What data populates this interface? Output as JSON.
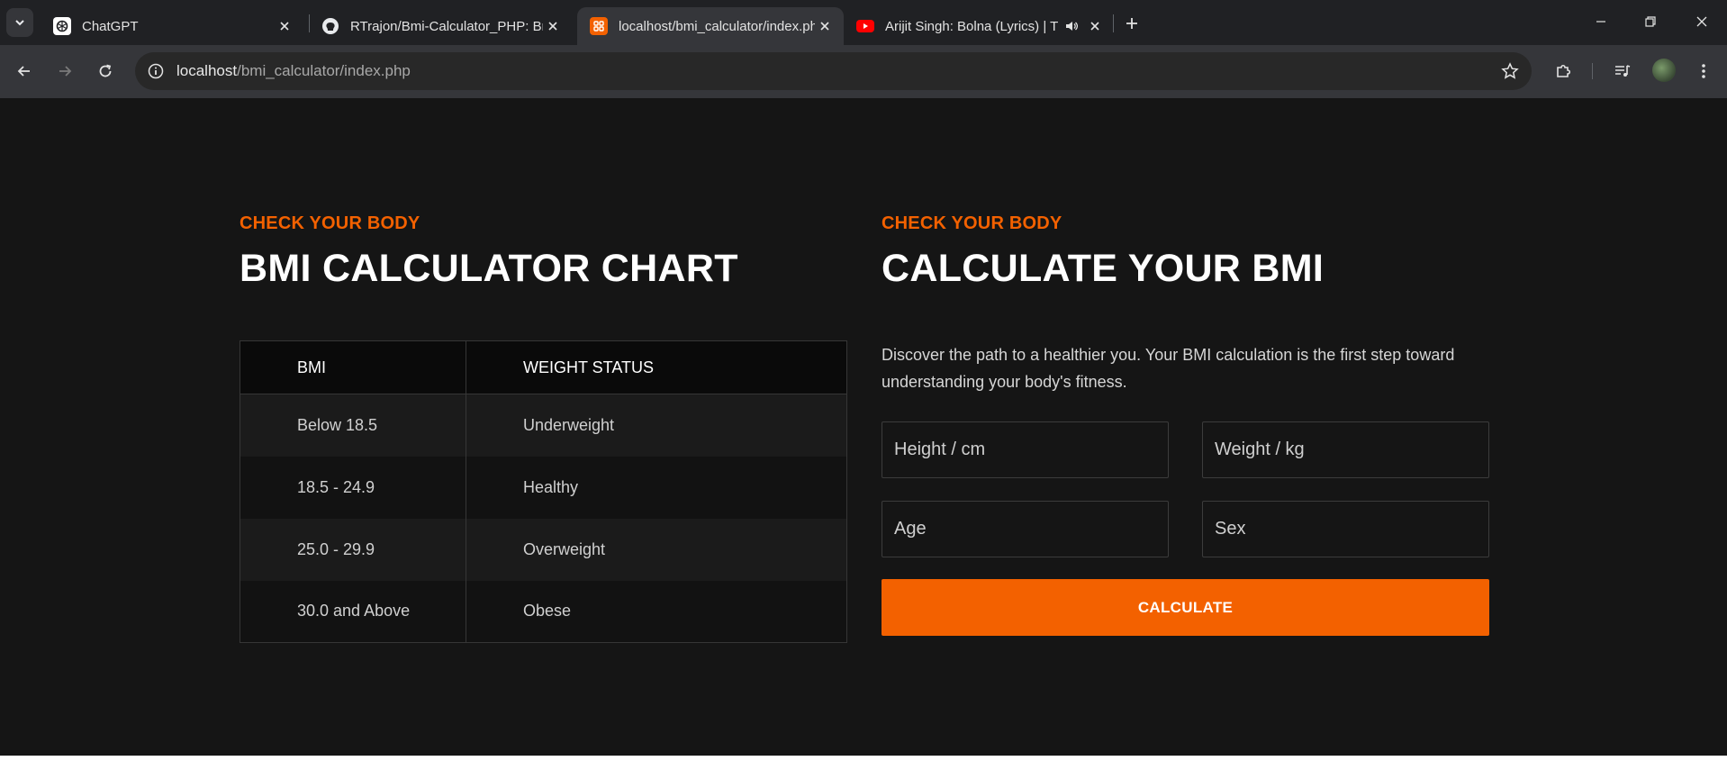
{
  "browser": {
    "tabs": [
      {
        "title": "ChatGPT",
        "icon": "chatgpt-icon",
        "active": false
      },
      {
        "title": "RTrajon/Bmi-Calculator_PHP: Bmi",
        "icon": "github-icon",
        "active": false
      },
      {
        "title": "localhost/bmi_calculator/index.php",
        "icon": "xampp-icon",
        "active": true
      },
      {
        "title": "Arijit Singh: Bolna (Lyrics) | T",
        "icon": "youtube-icon",
        "active": false,
        "audio": true
      }
    ],
    "url": {
      "host": "localhost",
      "path": "/bmi_calculator/index.php"
    }
  },
  "chart_section": {
    "eyebrow": "CHECK YOUR BODY",
    "title": "BMI CALCULATOR CHART",
    "table": {
      "headers": [
        "BMI",
        "WEIGHT STATUS"
      ],
      "rows": [
        [
          "Below 18.5",
          "Underweight"
        ],
        [
          "18.5 - 24.9",
          "Healthy"
        ],
        [
          "25.0 - 29.9",
          "Overweight"
        ],
        [
          "30.0 and Above",
          "Obese"
        ]
      ]
    }
  },
  "calc_section": {
    "eyebrow": "CHECK YOUR BODY",
    "title": "CALCULATE YOUR BMI",
    "description": "Discover the path to a healthier you. Your BMI calculation is the first step toward understanding your body's fitness.",
    "fields": {
      "height_placeholder": "Height / cm",
      "weight_placeholder": "Weight / kg",
      "age_placeholder": "Age",
      "sex_placeholder": "Sex"
    },
    "button_label": "CALCULATE"
  },
  "colors": {
    "accent": "#f36100",
    "page_bg": "#151515",
    "chrome_bg": "#202124",
    "toolbar_bg": "#35363a"
  }
}
